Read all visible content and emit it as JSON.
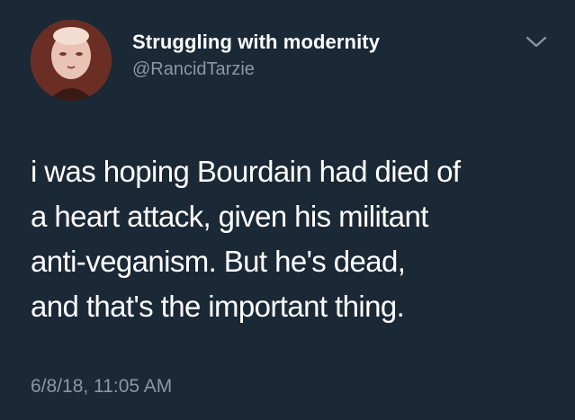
{
  "tweet": {
    "author": {
      "display_name": "Struggling with modernity",
      "handle": "@RancidTarzie",
      "avatar": "avatar-image"
    },
    "menu_icon": "chevron-down-icon",
    "text_lines": [
      "i was hoping Bourdain had died of",
      "a heart attack, given his militant",
      "anti-veganism. But he's dead,",
      "and that's the important thing."
    ],
    "timestamp": "6/8/18, 11:05 AM"
  },
  "colors": {
    "background": "#1b2836",
    "primary_text": "#ffffff",
    "secondary_text": "#8899a6"
  }
}
